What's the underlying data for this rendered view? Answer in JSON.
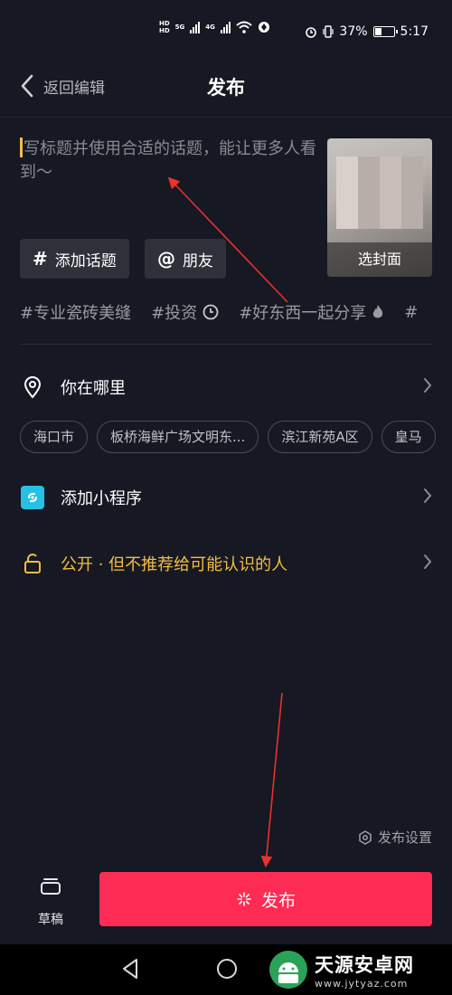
{
  "status_bar": {
    "hd_top": "HD",
    "hd_bottom": "HD",
    "net1": "5G",
    "net2": "4G",
    "battery_text": "37%",
    "battery_level": 0.37,
    "time": "5:17"
  },
  "header": {
    "back_label": "返回编辑",
    "title": "发布"
  },
  "caption": {
    "placeholder": "写标题并使用合适的话题，能让更多人看到～"
  },
  "cover": {
    "label": "选封面"
  },
  "chips": {
    "topic_symbol": "#",
    "topic_label": "添加话题",
    "friend_symbol": "@",
    "friend_label": "朋友"
  },
  "tags": [
    {
      "text": "#专业瓷砖美缝",
      "icon": ""
    },
    {
      "text": "#投资",
      "icon": "clock-icon"
    },
    {
      "text": "#好东西一起分享",
      "icon": "fire-icon"
    },
    {
      "text": "#",
      "icon": ""
    }
  ],
  "location": {
    "label": "你在哪里",
    "chips": [
      "海口市",
      "板桥海鲜广场文明东...",
      "滨江新苑A区",
      "皇马"
    ]
  },
  "mini_program": {
    "label": "添加小程序"
  },
  "privacy": {
    "label": "公开 · 但不推荐给可能认识的人",
    "color": "#f4bd44"
  },
  "publish_settings": {
    "label": "发布设置"
  },
  "bottom": {
    "draft_label": "草稿",
    "publish_label": "发布",
    "publish_color": "#fe2c55"
  },
  "watermark": {
    "title": "天源安卓网",
    "url": "www.jytyaz.com"
  }
}
